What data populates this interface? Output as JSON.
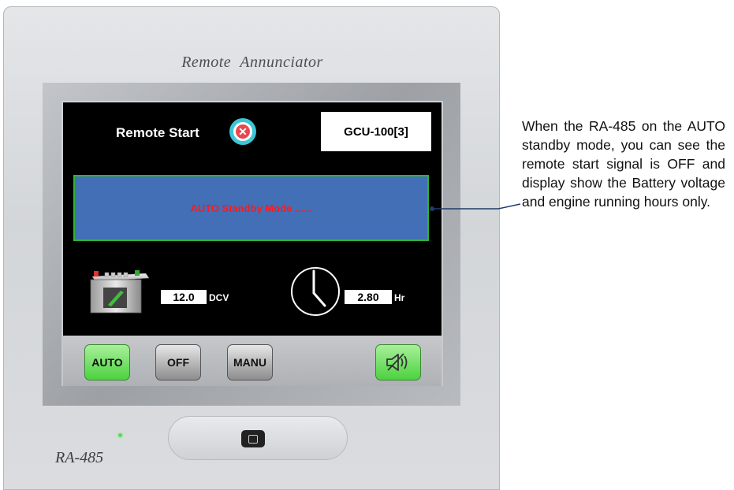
{
  "device": {
    "brand": "Remote  Annunciator",
    "model": "RA-485"
  },
  "screen": {
    "remote_start_label": "Remote Start",
    "remote_start_status_icon": "x-circle-icon",
    "unit_id": "GCU-100[3]",
    "mode_message": "AUTO Standby Mode ......",
    "battery": {
      "value": "12.0",
      "unit": "DCV",
      "icon": "battery-icon"
    },
    "hours": {
      "value": "2.80",
      "unit": "Hr",
      "icon": "clock-icon"
    },
    "buttons": {
      "auto": "AUTO",
      "off": "OFF",
      "manu": "MANU",
      "mute_icon": "mute-speaker-icon"
    }
  },
  "annotation": {
    "text": "When the RA-485 on the AUTO standby mode, you can see the remote start signal is OFF and display show the Battery voltage and engine running hours only."
  },
  "colors": {
    "mode_panel": "#436fb6",
    "mode_border": "#2fb52f",
    "mode_text": "#ff1a1a",
    "active_button": "#4cd23f"
  }
}
